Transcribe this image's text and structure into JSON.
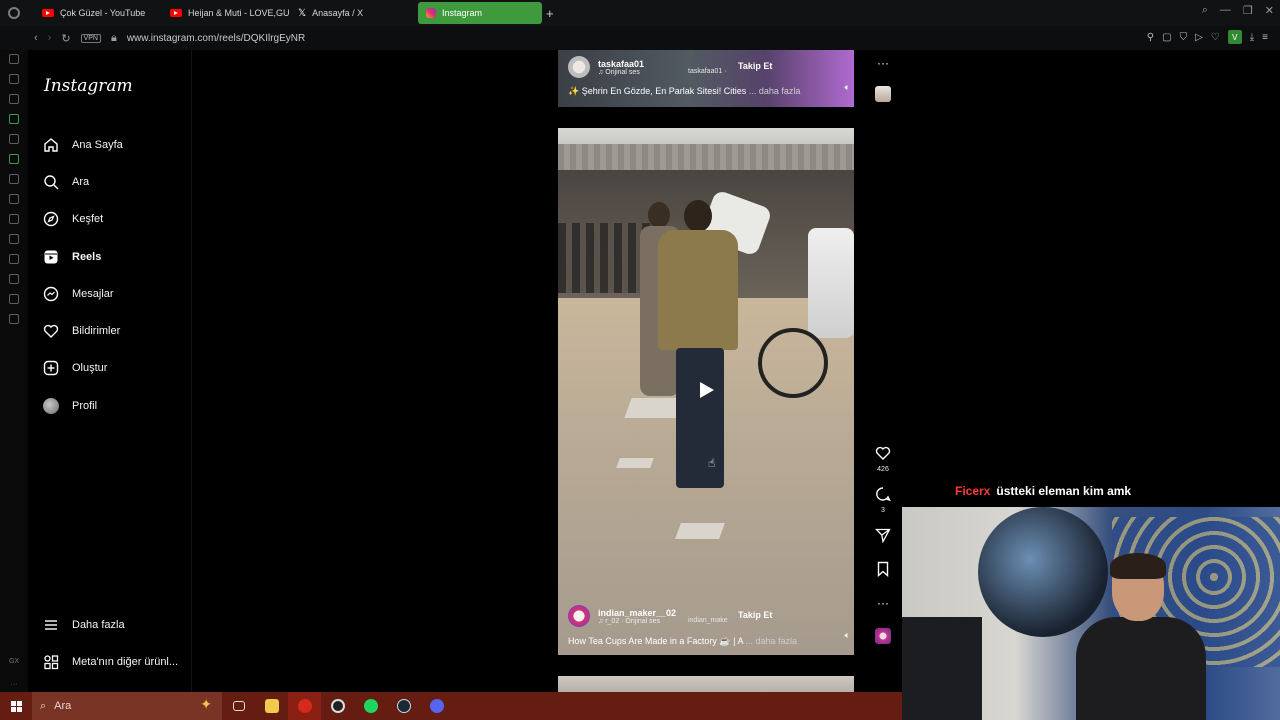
{
  "browser": {
    "tabs": [
      {
        "label": "Çok Güzel - YouTube",
        "icon": "youtube-icon",
        "active": false
      },
      {
        "label": "Heijan & Muti - LOVE,GU…",
        "icon": "youtube-icon",
        "active": false
      },
      {
        "label": "Anasayfa / X",
        "icon": "x-icon",
        "active": false
      },
      {
        "label": "Instagram",
        "icon": "instagram-icon",
        "active": true
      }
    ],
    "new_tab": "+",
    "url": "www.instagram.com/reels/DQKIlrgEyNR",
    "vpn_label": "VPN",
    "profile_initial": "V",
    "accent": "#3e9a3c"
  },
  "instagram": {
    "logo": "Instagram",
    "nav": [
      {
        "label": "Ana Sayfa",
        "icon": "home-icon"
      },
      {
        "label": "Ara",
        "icon": "search-icon"
      },
      {
        "label": "Keşfet",
        "icon": "compass-icon"
      },
      {
        "label": "Reels",
        "icon": "reels-icon",
        "active": true
      },
      {
        "label": "Mesajlar",
        "icon": "messenger-icon"
      },
      {
        "label": "Bildirimler",
        "icon": "heart-icon"
      },
      {
        "label": "Oluştur",
        "icon": "plus-square-icon"
      },
      {
        "label": "Profil",
        "icon": "avatar"
      }
    ],
    "nav_bottom": [
      {
        "label": "Daha fazla",
        "icon": "menu-icon"
      },
      {
        "label": "Meta'nın diğer ürünl...",
        "icon": "meta-grid-icon"
      }
    ]
  },
  "reels": {
    "top": {
      "username": "taskafaa01",
      "audio": "Orijinal ses",
      "audio_user": "taskafaa01 ·",
      "follow": "Takip Et",
      "caption": "✨ Şehrin En Gözde, En Parlak Sitesi! Cities",
      "more": "... daha fazla"
    },
    "main": {
      "username": "indian_maker__02",
      "audio": "r_02 · Orijinal ses",
      "audio_user": "indian_make",
      "follow": "Takip Et",
      "caption": "How Tea Cups Are Made in a Factory ☕ | A",
      "more": "... daha fazla",
      "likes": "426",
      "comments": "3"
    }
  },
  "stream": {
    "chat_user": "Ficerx",
    "chat_message": "üstteki eleman kim amk",
    "chat_user_color": "#ff3b3b"
  },
  "taskbar": {
    "search_placeholder": "Ara",
    "color": "#641d10",
    "apps": [
      "task-view-icon",
      "file-explorer-icon",
      "opera-gx-icon",
      "chrome-icon",
      "spotify-icon",
      "steam-icon",
      "discord-icon"
    ]
  }
}
